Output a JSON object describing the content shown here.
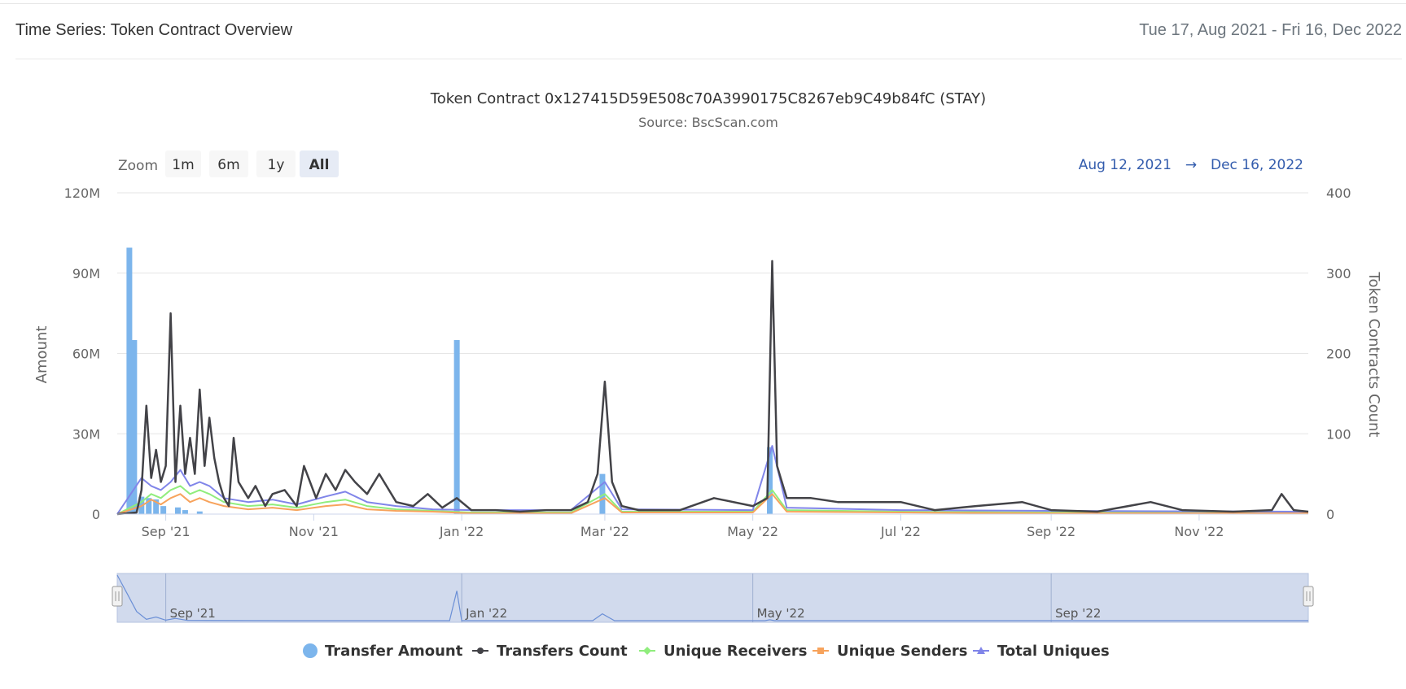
{
  "header": {
    "title": "Time Series: Token Contract Overview",
    "date_range": "Tue 17, Aug 2021 - Fri 16, Dec 2022"
  },
  "chart": {
    "title": "Token Contract 0x127415D59E508c70A3990175C8267eb9C49b84fC (STAY)",
    "subtitle": "Source: BscScan.com",
    "zoom_label": "Zoom",
    "zoom_buttons": [
      "1m",
      "6m",
      "1y",
      "All"
    ],
    "zoom_selected": "All",
    "range_from": "Aug 12, 2021",
    "range_arrow": "→",
    "range_to": "Dec 16, 2022",
    "y_left_title": "Amount",
    "y_right_title": "Token Contracts Count",
    "y_left_ticks": [
      "0",
      "30M",
      "60M",
      "90M",
      "120M"
    ],
    "y_right_ticks": [
      "0",
      "100",
      "200",
      "300",
      "400"
    ],
    "x_ticks": [
      "Sep '21",
      "Nov '21",
      "Jan '22",
      "Mar '22",
      "May '22",
      "Jul '22",
      "Sep '22",
      "Nov '22"
    ],
    "navigator_ticks": [
      "Sep '21",
      "Jan '22",
      "May '22",
      "Sep '22"
    ],
    "legend": [
      "Transfer Amount",
      "Transfers Count",
      "Unique Receivers",
      "Unique Senders",
      "Total Uniques"
    ],
    "colors": {
      "transfer_amount": "#7cb5ec",
      "transfers_count": "#434348",
      "unique_receivers": "#90ed7d",
      "unique_senders": "#f7a35c",
      "total_uniques": "#8085e9",
      "navigator_fill": "#ccd6eb",
      "range_text": "#335cad"
    }
  },
  "chart_data": {
    "type": "bar+line",
    "title": "Token Contract 0x127415D59E508c70A3990175C8267eb9C49b84fC (STAY)",
    "subtitle": "Source: BscScan.com",
    "x_range": [
      "2021-08-12",
      "2022-12-16"
    ],
    "y_left": {
      "title": "Amount",
      "range": [
        0,
        120000000
      ]
    },
    "y_right": {
      "title": "Token Contracts Count",
      "range": [
        0,
        400
      ]
    },
    "bar_series": {
      "name": "Transfer Amount",
      "axis": "left",
      "points": [
        [
          "2021-08-17",
          99500000
        ],
        [
          "2021-08-19",
          65000000
        ],
        [
          "2021-08-22",
          6500000
        ],
        [
          "2021-08-25",
          6000000
        ],
        [
          "2021-08-28",
          5500000
        ],
        [
          "2021-08-31",
          3000000
        ],
        [
          "2021-09-06",
          2500000
        ],
        [
          "2021-09-09",
          1500000
        ],
        [
          "2021-09-15",
          1000000
        ],
        [
          "2021-12-30",
          65000000
        ],
        [
          "2022-02-28",
          15000000
        ],
        [
          "2022-05-08",
          25000000
        ]
      ]
    },
    "line_series": [
      {
        "name": "Transfers Count",
        "axis": "right",
        "points": [
          [
            "2021-08-12",
            0
          ],
          [
            "2021-08-20",
            2
          ],
          [
            "2021-08-22",
            30
          ],
          [
            "2021-08-24",
            135
          ],
          [
            "2021-08-26",
            45
          ],
          [
            "2021-08-28",
            80
          ],
          [
            "2021-08-30",
            40
          ],
          [
            "2021-09-01",
            60
          ],
          [
            "2021-09-03",
            250
          ],
          [
            "2021-09-05",
            40
          ],
          [
            "2021-09-07",
            135
          ],
          [
            "2021-09-09",
            50
          ],
          [
            "2021-09-11",
            95
          ],
          [
            "2021-09-13",
            50
          ],
          [
            "2021-09-15",
            155
          ],
          [
            "2021-09-17",
            60
          ],
          [
            "2021-09-19",
            120
          ],
          [
            "2021-09-21",
            70
          ],
          [
            "2021-09-23",
            40
          ],
          [
            "2021-09-25",
            20
          ],
          [
            "2021-09-27",
            10
          ],
          [
            "2021-09-29",
            95
          ],
          [
            "2021-10-01",
            40
          ],
          [
            "2021-10-05",
            20
          ],
          [
            "2021-10-08",
            35
          ],
          [
            "2021-10-12",
            10
          ],
          [
            "2021-10-15",
            25
          ],
          [
            "2021-10-20",
            30
          ],
          [
            "2021-10-25",
            10
          ],
          [
            "2021-10-28",
            60
          ],
          [
            "2021-11-02",
            20
          ],
          [
            "2021-11-06",
            50
          ],
          [
            "2021-11-10",
            30
          ],
          [
            "2021-11-14",
            55
          ],
          [
            "2021-11-18",
            40
          ],
          [
            "2021-11-23",
            25
          ],
          [
            "2021-11-28",
            50
          ],
          [
            "2021-12-05",
            15
          ],
          [
            "2021-12-12",
            10
          ],
          [
            "2021-12-18",
            25
          ],
          [
            "2021-12-24",
            8
          ],
          [
            "2021-12-30",
            20
          ],
          [
            "2022-01-05",
            5
          ],
          [
            "2022-01-15",
            5
          ],
          [
            "2022-01-25",
            3
          ],
          [
            "2022-02-05",
            5
          ],
          [
            "2022-02-15",
            5
          ],
          [
            "2022-02-22",
            15
          ],
          [
            "2022-02-26",
            50
          ],
          [
            "2022-03-01",
            165
          ],
          [
            "2022-03-04",
            40
          ],
          [
            "2022-03-08",
            10
          ],
          [
            "2022-03-15",
            5
          ],
          [
            "2022-04-01",
            5
          ],
          [
            "2022-04-15",
            20
          ],
          [
            "2022-05-01",
            10
          ],
          [
            "2022-05-07",
            20
          ],
          [
            "2022-05-09",
            315
          ],
          [
            "2022-05-11",
            60
          ],
          [
            "2022-05-15",
            20
          ],
          [
            "2022-05-25",
            20
          ],
          [
            "2022-06-05",
            15
          ],
          [
            "2022-06-18",
            15
          ],
          [
            "2022-07-01",
            15
          ],
          [
            "2022-07-15",
            5
          ],
          [
            "2022-08-01",
            10
          ],
          [
            "2022-08-20",
            15
          ],
          [
            "2022-09-01",
            5
          ],
          [
            "2022-09-20",
            3
          ],
          [
            "2022-10-12",
            15
          ],
          [
            "2022-10-25",
            5
          ],
          [
            "2022-11-15",
            3
          ],
          [
            "2022-12-01",
            5
          ],
          [
            "2022-12-05",
            25
          ],
          [
            "2022-12-10",
            5
          ],
          [
            "2022-12-16",
            3
          ]
        ]
      },
      {
        "name": "Unique Receivers",
        "axis": "right",
        "points": [
          [
            "2021-08-12",
            0
          ],
          [
            "2021-08-22",
            15
          ],
          [
            "2021-08-26",
            25
          ],
          [
            "2021-08-30",
            20
          ],
          [
            "2021-09-03",
            30
          ],
          [
            "2021-09-07",
            35
          ],
          [
            "2021-09-11",
            25
          ],
          [
            "2021-09-15",
            30
          ],
          [
            "2021-09-19",
            25
          ],
          [
            "2021-09-25",
            15
          ],
          [
            "2021-10-05",
            10
          ],
          [
            "2021-10-15",
            12
          ],
          [
            "2021-10-25",
            8
          ],
          [
            "2021-11-06",
            15
          ],
          [
            "2021-11-14",
            18
          ],
          [
            "2021-11-23",
            10
          ],
          [
            "2021-12-05",
            6
          ],
          [
            "2021-12-20",
            4
          ],
          [
            "2022-01-05",
            2
          ],
          [
            "2022-02-15",
            2
          ],
          [
            "2022-03-01",
            25
          ],
          [
            "2022-03-08",
            3
          ],
          [
            "2022-05-01",
            3
          ],
          [
            "2022-05-09",
            30
          ],
          [
            "2022-05-15",
            5
          ],
          [
            "2022-07-01",
            3
          ],
          [
            "2022-09-01",
            2
          ],
          [
            "2022-12-16",
            2
          ]
        ]
      },
      {
        "name": "Unique Senders",
        "axis": "right",
        "points": [
          [
            "2021-08-12",
            0
          ],
          [
            "2021-08-22",
            10
          ],
          [
            "2021-08-26",
            18
          ],
          [
            "2021-08-30",
            12
          ],
          [
            "2021-09-03",
            20
          ],
          [
            "2021-09-07",
            25
          ],
          [
            "2021-09-11",
            15
          ],
          [
            "2021-09-15",
            20
          ],
          [
            "2021-09-19",
            15
          ],
          [
            "2021-09-25",
            10
          ],
          [
            "2021-10-05",
            6
          ],
          [
            "2021-10-15",
            8
          ],
          [
            "2021-10-25",
            5
          ],
          [
            "2021-11-06",
            10
          ],
          [
            "2021-11-14",
            12
          ],
          [
            "2021-11-23",
            6
          ],
          [
            "2021-12-05",
            4
          ],
          [
            "2021-12-20",
            3
          ],
          [
            "2022-01-05",
            1
          ],
          [
            "2022-02-15",
            1
          ],
          [
            "2022-03-01",
            20
          ],
          [
            "2022-03-08",
            2
          ],
          [
            "2022-05-01",
            2
          ],
          [
            "2022-05-09",
            25
          ],
          [
            "2022-05-15",
            3
          ],
          [
            "2022-07-01",
            2
          ],
          [
            "2022-09-01",
            1
          ],
          [
            "2022-12-16",
            1
          ]
        ]
      },
      {
        "name": "Total Uniques",
        "axis": "right",
        "points": [
          [
            "2021-08-12",
            0
          ],
          [
            "2021-08-22",
            45
          ],
          [
            "2021-08-26",
            35
          ],
          [
            "2021-08-30",
            30
          ],
          [
            "2021-09-03",
            40
          ],
          [
            "2021-09-07",
            55
          ],
          [
            "2021-09-11",
            35
          ],
          [
            "2021-09-15",
            40
          ],
          [
            "2021-09-19",
            35
          ],
          [
            "2021-09-25",
            20
          ],
          [
            "2021-10-05",
            15
          ],
          [
            "2021-10-15",
            18
          ],
          [
            "2021-10-25",
            12
          ],
          [
            "2021-11-06",
            22
          ],
          [
            "2021-11-14",
            28
          ],
          [
            "2021-11-23",
            15
          ],
          [
            "2021-12-05",
            10
          ],
          [
            "2021-12-20",
            6
          ],
          [
            "2022-01-05",
            5
          ],
          [
            "2022-02-15",
            5
          ],
          [
            "2022-03-01",
            40
          ],
          [
            "2022-03-08",
            6
          ],
          [
            "2022-05-01",
            5
          ],
          [
            "2022-05-09",
            85
          ],
          [
            "2022-05-15",
            8
          ],
          [
            "2022-07-01",
            5
          ],
          [
            "2022-09-01",
            4
          ],
          [
            "2022-12-16",
            3
          ]
        ]
      }
    ],
    "x_tick_labels": [
      "Sep '21",
      "Nov '21",
      "Jan '22",
      "Mar '22",
      "May '22",
      "Jul '22",
      "Sep '22",
      "Nov '22"
    ],
    "grid": true,
    "legend_position": "bottom"
  }
}
